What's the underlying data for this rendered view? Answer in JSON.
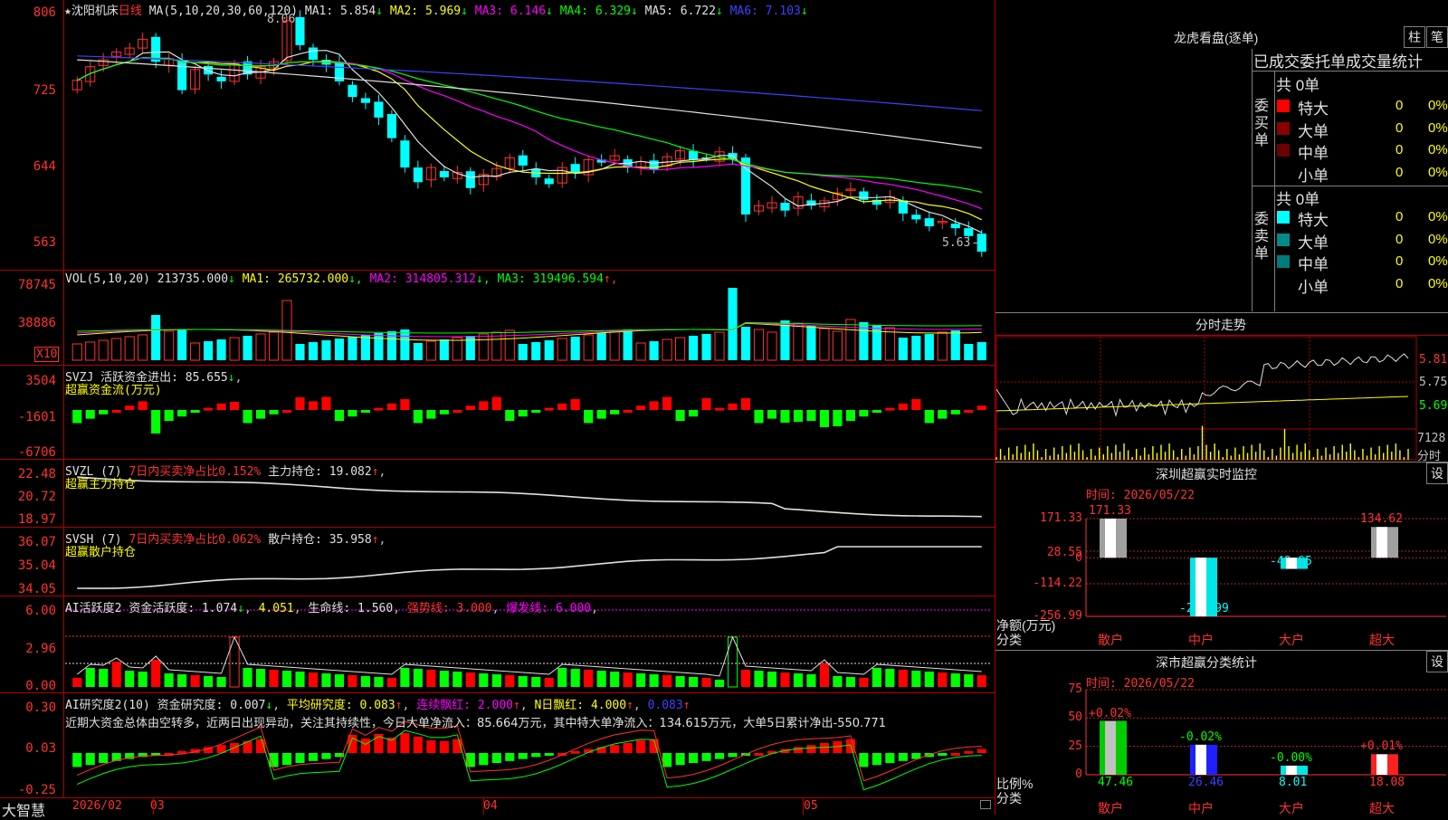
{
  "stock": {
    "star": "★",
    "name": "沈阳机床",
    "period": "日线"
  },
  "main": {
    "ma_params": "MA(5,10,20,30,60,120)",
    "ma": [
      {
        "label": "MA1:",
        "value": "5.854",
        "arrow": "↓",
        "color": "#e0e0e0"
      },
      {
        "label": "MA2:",
        "value": "5.969",
        "arrow": "↓",
        "color": "#ffff00"
      },
      {
        "label": "MA3:",
        "value": "6.146",
        "arrow": "↓",
        "color": "#ff00ff"
      },
      {
        "label": "MA4:",
        "value": "6.329",
        "arrow": "↓",
        "color": "#00ff00"
      },
      {
        "label": "MA5:",
        "value": "6.722",
        "arrow": "↓",
        "color": "#e0e0e0"
      },
      {
        "label": "MA6:",
        "value": "7.103",
        "arrow": "↓",
        "color": "#4040ff"
      }
    ],
    "y_ticks": [
      "806",
      "725",
      "644",
      "563"
    ],
    "high_label": "8.06",
    "low_label": "5.63",
    "closes": [
      7.41,
      7.55,
      7.62,
      7.7,
      7.74,
      7.83,
      7.6,
      7.63,
      7.31,
      7.52,
      7.47,
      7.4,
      7.58,
      7.47,
      7.55,
      7.6,
      8.02,
      7.77,
      7.62,
      7.57,
      7.4,
      7.24,
      7.18,
      7.03,
      6.82,
      6.52,
      6.37,
      6.52,
      6.42,
      6.47,
      6.31,
      6.45,
      6.51,
      6.62,
      6.54,
      6.42,
      6.35,
      6.52,
      6.47,
      6.6,
      6.57,
      6.64,
      6.53,
      6.58,
      6.5,
      6.63,
      6.69,
      6.6,
      6.62,
      6.68,
      6.61,
      6.04,
      6.13,
      6.16,
      6.08,
      6.22,
      6.13,
      6.18,
      6.26,
      6.3,
      6.19,
      6.14,
      6.22,
      6.05,
      5.99,
      5.92,
      5.97,
      5.9,
      5.82,
      5.66
    ]
  },
  "vol": {
    "params": "VOL(5,10,20)",
    "value": "213735.000",
    "value_arrow": "↓",
    "ma": [
      {
        "label": "MA1:",
        "value": "265732.000",
        "arrow": "↓",
        "color": "#ffff00"
      },
      {
        "label": "MA2:",
        "value": "314805.312",
        "arrow": "↓",
        "color": "#ff00ff"
      },
      {
        "label": "MA3:",
        "value": "319496.594",
        "arrow": "↑",
        "color": "#00ff00"
      }
    ],
    "y_ticks": [
      "78745",
      "38886"
    ],
    "unit": "X10"
  },
  "svzj": {
    "name": "SVZJ",
    "label": "活跃资金进出:",
    "value": "85.655",
    "arrow": "↓",
    "subtitle": "超赢资金流(万元)",
    "y_ticks": [
      "3504",
      "-1601",
      "-6706"
    ]
  },
  "svzl": {
    "name": "SVZL (7)",
    "ratio_label": "7日内买卖净占比0.152%",
    "hold_label": "主力持仓:",
    "hold_value": "19.082",
    "arrow": "↑",
    "subtitle": "超赢主力持仓",
    "y_ticks": [
      "22.48",
      "20.72",
      "18.97"
    ]
  },
  "svsh": {
    "name": "SVSH (7)",
    "ratio_label": "7日内买卖净占比0.062%",
    "hold_label": "散户持仓:",
    "hold_value": "35.958",
    "arrow": "↑",
    "subtitle": "超赢散户持仓",
    "y_ticks": [
      "36.07",
      "35.04",
      "34.05"
    ]
  },
  "ai_active": {
    "name": "AI活跃度2",
    "label": "资金活跃度:",
    "value": "1.074",
    "arrow": "↓",
    "value2": "4.051",
    "life_label": "生命线:",
    "life_value": "1.560",
    "strong": "强势线: 3.000",
    "burst": "爆发线: 6.000",
    "y_ticks": [
      "6.00",
      "2.96",
      "0.00"
    ]
  },
  "ai_research": {
    "name": "AI研究度2(10)",
    "label": "资金研究度:",
    "value": "0.007",
    "arrow": "↓",
    "avg": "平均研究度: 0.083",
    "red_days": "连续飘红: 2.000",
    "n_red": "N日飘红: 4.000",
    "extra": "0.083",
    "comment": "近期大资金总体由空转多，近两日出现异动，关注其持续性，今日大单净流入：85.664万元，其中特大单净流入：134.615万元，大单5日累计净出-550.771",
    "y_ticks": [
      "0.30",
      "0.03",
      "-0.25"
    ]
  },
  "footer": {
    "brand": "大智慧",
    "dates": [
      "2026/02",
      "03",
      "04",
      "05"
    ]
  },
  "longhu": {
    "title": "龙虎看盘(逐单)",
    "btn1": "柱",
    "btn2": "笔",
    "subtitle": "已成交委托单成交量统计",
    "buy_side": "委买单",
    "sell_side": "委卖单",
    "buy_total": "共 0单",
    "sell_total": "共 0单",
    "buy_rows": [
      {
        "label": "特大",
        "qty": "0",
        "pct": "0%",
        "color": "#ff0000"
      },
      {
        "label": "大单",
        "qty": "0",
        "pct": "0%",
        "color": "#8b0000"
      },
      {
        "label": "中单",
        "qty": "0",
        "pct": "0%",
        "color": "#6b0000"
      },
      {
        "label": "小单",
        "qty": "0",
        "pct": "0%",
        "color": ""
      }
    ],
    "sell_rows": [
      {
        "label": "特大",
        "qty": "0",
        "pct": "0%",
        "color": "#00ffff"
      },
      {
        "label": "大单",
        "qty": "0",
        "pct": "0%",
        "color": "#008b8b"
      },
      {
        "label": "中单",
        "qty": "0",
        "pct": "0%",
        "color": "#007a7a"
      },
      {
        "label": "小单",
        "qty": "0",
        "pct": "0%",
        "color": ""
      }
    ]
  },
  "intraday": {
    "title": "分时走势",
    "y_ticks": [
      "5.81",
      "5.75",
      "5.69"
    ],
    "vol_label": "7128",
    "vol_unit": "分时"
  },
  "sz_monitor": {
    "title": "深圳超赢实时监控",
    "btn": "设",
    "time": "时间: 2026/05/22",
    "y_ticks": [
      "171.33",
      "28.55",
      "0",
      "-114.22",
      "-256.99"
    ],
    "y_unit": "净额(万元)",
    "x_unit": "分类",
    "chart_data": {
      "type": "bar",
      "categories": [
        "散户",
        "中户",
        "大户",
        "超大"
      ],
      "values": [
        171.33,
        -256.99,
        -48.95,
        134.62
      ],
      "value_labels": [
        "171.33",
        "-256.99",
        "-48.95",
        "134.62"
      ],
      "ylim": [
        -256.99,
        171.33
      ]
    }
  },
  "sz_class": {
    "title": "深市超赢分类统计",
    "btn": "设",
    "time": "时间: 2026/05/22",
    "y_ticks": [
      "75",
      "50",
      "25",
      "0"
    ],
    "y_unit": "比例%",
    "x_unit": "分类",
    "chart_data": {
      "type": "bar",
      "categories": [
        "散户",
        "中户",
        "大户",
        "超大"
      ],
      "values": [
        47.46,
        26.46,
        8.01,
        18.08
      ],
      "value_labels": [
        "47.46",
        "26.46",
        "8.01",
        "18.08"
      ],
      "changes": [
        "+0.02%",
        "-0.02%",
        "-0.00%",
        "+0.01%"
      ],
      "ylim": [
        0,
        75
      ]
    }
  }
}
